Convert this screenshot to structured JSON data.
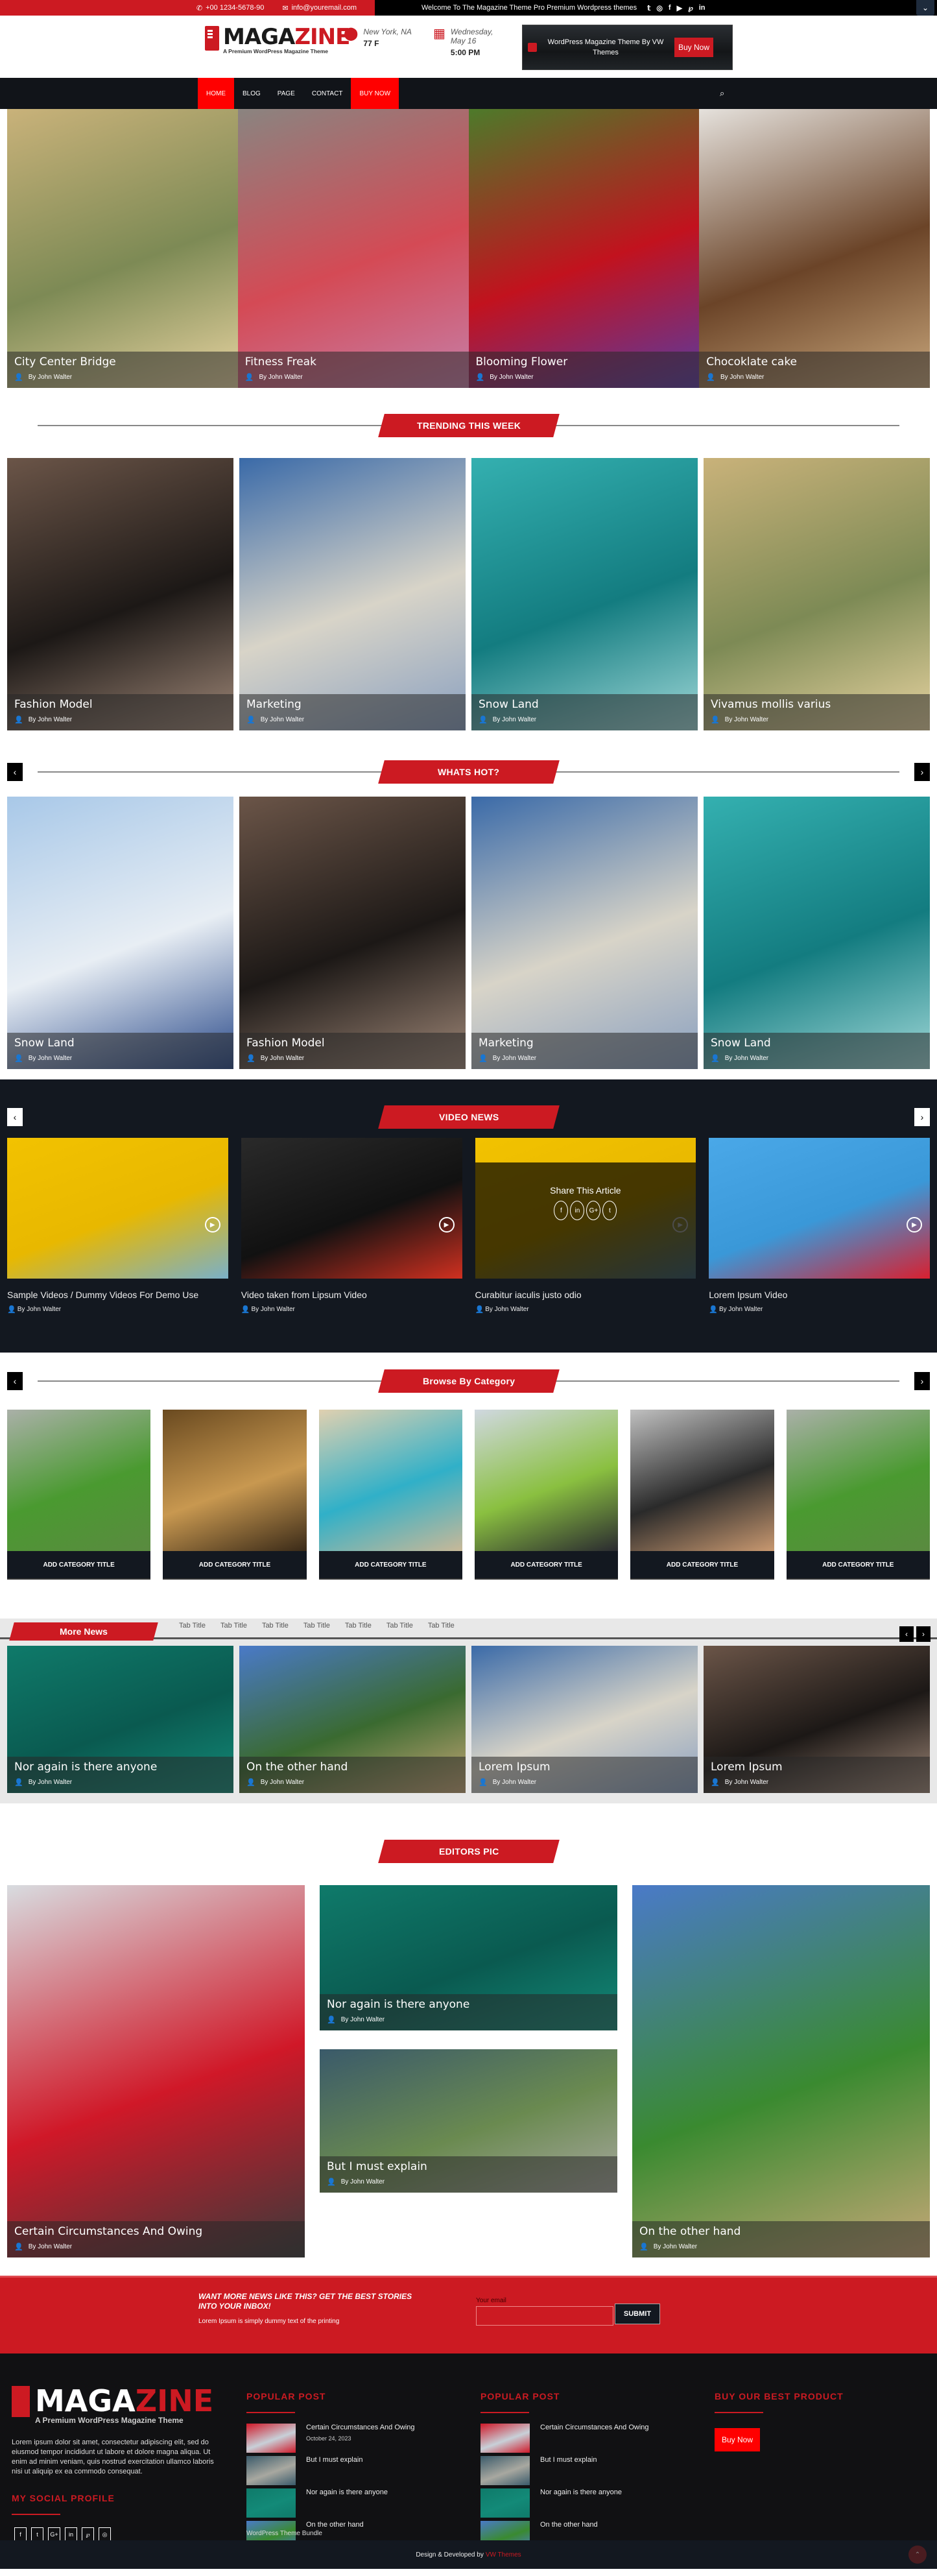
{
  "topbar": {
    "phone": "+00 1234-5678-90",
    "email": "info@youremail.com",
    "welcome": "Welcome To The Magazine Theme Pro Premium Wordpress themes",
    "social": [
      "twitter-icon",
      "instagram-icon",
      "facebook-icon",
      "youtube-icon",
      "pinterest-icon",
      "linkedin-icon"
    ],
    "social_glyphs": [
      "𝕥",
      "◎",
      "f",
      "▶",
      "℘",
      "in"
    ],
    "toggle": "⌄"
  },
  "header": {
    "logo_main": "MAGA",
    "logo_accent": "ZINE",
    "logo_tagline": "A Premium WordPress Magazine Theme",
    "location": "New York, NA",
    "temperature": "77 F",
    "date_line1": "Wednesday,",
    "date_line2": "May 16",
    "time": "5:00 PM",
    "ad_text": "WordPress Magazine Theme By VW Themes",
    "ad_button": "Buy Now"
  },
  "nav": {
    "items": [
      {
        "label": "HOME",
        "active": true
      },
      {
        "label": "BLOG",
        "active": false
      },
      {
        "label": "PAGE",
        "active": false
      },
      {
        "label": "CONTACT",
        "active": false
      },
      {
        "label": "BUY NOW",
        "active": true
      }
    ],
    "search_icon": "⌕"
  },
  "author": "By John Walter",
  "hero": [
    {
      "title": "City Center Bridge",
      "colors": [
        "#c9b27a",
        "#7d8a55",
        "#e7d3a0"
      ]
    },
    {
      "title": "Fitness Freak",
      "colors": [
        "#8a8480",
        "#d44a55",
        "#c67fa8"
      ]
    },
    {
      "title": "Blooming Flower",
      "colors": [
        "#4d7a2a",
        "#c2121e",
        "#5a3aa0"
      ]
    },
    {
      "title": "Chocoklate cake",
      "colors": [
        "#e5e1dc",
        "#6b4428",
        "#c9a77c"
      ]
    }
  ],
  "sections": {
    "trending": "TRENDING THIS WEEK",
    "whats_hot": "WHATS HOT?",
    "video_news": "VIDEO NEWS",
    "browse": "Browse By Category",
    "more_news": "More News",
    "editors": "EDITORS PIC"
  },
  "trending": [
    {
      "title": "Fashion Model",
      "colors": [
        "#6b5548",
        "#1c1816",
        "#a08878"
      ]
    },
    {
      "title": "Marketing",
      "colors": [
        "#3a6aa8",
        "#d8d4c8",
        "#8aa0c0"
      ]
    },
    {
      "title": "Snow Land",
      "colors": [
        "#34b0b0",
        "#137c80",
        "#a0d8d8"
      ]
    },
    {
      "title": "Vivamus mollis varius",
      "colors": [
        "#c9b27a",
        "#7d8a55",
        "#e7d3a0"
      ]
    }
  ],
  "whats_hot": [
    {
      "title": "Snow Land",
      "colors": [
        "#a8c8e8",
        "#e8eef4",
        "#2a4a8a"
      ]
    },
    {
      "title": "Fashion Model",
      "colors": [
        "#6b5548",
        "#1c1816",
        "#a08878"
      ]
    },
    {
      "title": "Marketing",
      "colors": [
        "#3a6aa8",
        "#d8d4c8",
        "#8aa0c0"
      ]
    },
    {
      "title": "Snow Land",
      "colors": [
        "#34b0b0",
        "#137c80",
        "#a0d8d8"
      ]
    }
  ],
  "videos": [
    {
      "title": "Sample Videos / Dummy Videos For Demo Use",
      "colors": [
        "#f2c200",
        "#e8b800",
        "#7ab0c8"
      ],
      "share": false
    },
    {
      "title": "Video taken from Lipsum Video",
      "colors": [
        "#2a2a2a",
        "#111",
        "#d03020"
      ],
      "share": false
    },
    {
      "title": "Curabitur iaculis justo odio",
      "colors": [
        "#f2c200",
        "#e8b800",
        "#7ab0c8"
      ],
      "share": true
    },
    {
      "title": "Lorem Ipsum Video",
      "colors": [
        "#4aa8e8",
        "#3a98d8",
        "#d82030"
      ],
      "share": false
    }
  ],
  "share": {
    "title": "Share This Article",
    "icons": [
      {
        "name": "facebook-icon",
        "glyph": "f"
      },
      {
        "name": "linkedin-icon",
        "glyph": "in"
      },
      {
        "name": "google-plus-icon",
        "glyph": "G+"
      },
      {
        "name": "twitter-icon",
        "glyph": "t"
      }
    ]
  },
  "categories": [
    {
      "label": "ADD CATEGORY TITLE",
      "colors": [
        "#aab0a8",
        "#4a9a30",
        "#5a8a40"
      ]
    },
    {
      "label": "ADD CATEGORY TITLE",
      "colors": [
        "#6a4a20",
        "#c89850",
        "#3a2a18"
      ]
    },
    {
      "label": "ADD CATEGORY TITLE",
      "colors": [
        "#e0d0b0",
        "#30b0c8",
        "#c8b898"
      ]
    },
    {
      "label": "ADD CATEGORY TITLE",
      "colors": [
        "#d0d8e0",
        "#8ac040",
        "#2a2a30"
      ]
    },
    {
      "label": "ADD CATEGORY TITLE",
      "colors": [
        "#c0c0c0",
        "#2a2a2a",
        "#c89870"
      ]
    },
    {
      "label": "ADD CATEGORY TITLE",
      "colors": [
        "#aab0a8",
        "#4a9a30",
        "#5a8a40"
      ]
    }
  ],
  "more_news": {
    "tabs": [
      "Tab Title",
      "Tab Title",
      "Tab Title",
      "Tab Title",
      "Tab Title",
      "Tab Title",
      "Tab Title"
    ],
    "cards": [
      {
        "title": "Nor again is there anyone",
        "colors": [
          "#0f7a6a",
          "#0a5a50",
          "#138a78"
        ]
      },
      {
        "title": "On the other hand",
        "colors": [
          "#4a7ac8",
          "#3a6a30",
          "#c8a878"
        ]
      },
      {
        "title": "Lorem Ipsum",
        "colors": [
          "#3a6aa8",
          "#d8d4c8",
          "#8aa0c0"
        ]
      },
      {
        "title": "Lorem Ipsum",
        "colors": [
          "#6b5548",
          "#1c1816",
          "#a08878"
        ]
      }
    ]
  },
  "editors": {
    "left": {
      "title": "Certain Circumstances And Owing",
      "colors": [
        "#d8dce0",
        "#d01828",
        "#3a3a3a"
      ]
    },
    "mid_top": {
      "title": "Nor again is there anyone",
      "colors": [
        "#0f7a6a",
        "#0a5a50",
        "#138a78"
      ]
    },
    "mid_bottom": {
      "title": "But I must explain",
      "colors": [
        "#3a5a6a",
        "#6a8a50",
        "#a8a8a0"
      ]
    },
    "right": {
      "title": "On the other hand",
      "colors": [
        "#4a7ac8",
        "#3a8a30",
        "#c8a878"
      ]
    }
  },
  "newsletter": {
    "heading": "WANT MORE NEWS LIKE THIS? GET THE BEST STORIES INTO YOUR INBOX!",
    "text": "Lorem Ipsum is simply dummy text of the printing",
    "email_label": "Your email",
    "email_value": "",
    "submit": "SUBMIT"
  },
  "footer": {
    "logo_main": "MAGA",
    "logo_accent": "ZINE",
    "logo_tagline": "A Premium WordPress Magazine Theme",
    "description": "Lorem ipsum dolor sit amet, consectetur adipiscing elit, sed do eiusmod tempor incididunt ut labore et dolore magna aliqua. Ut enim ad minim veniam, quis nostrud exercitation ullamco laboris nisi ut aliquip ex ea commodo consequat.",
    "social_heading": "MY SOCIAL PROFILE",
    "social": [
      {
        "name": "facebook-icon",
        "glyph": "f"
      },
      {
        "name": "twitter-icon",
        "glyph": "t"
      },
      {
        "name": "google-plus-icon",
        "glyph": "G+"
      },
      {
        "name": "linkedin-icon",
        "glyph": "in"
      },
      {
        "name": "pinterest-icon",
        "glyph": "℘"
      },
      {
        "name": "instagram-icon",
        "glyph": "◎"
      }
    ],
    "popular_heading": "POPULAR POST",
    "popular_1": [
      {
        "title": "Certain Circumstances And Owing",
        "date": "October 24, 2023",
        "colors": [
          "#d01828",
          "#c8d0d8"
        ]
      },
      {
        "title": "But I must explain",
        "date": "",
        "colors": [
          "#3a5a6a",
          "#a8a8a0"
        ]
      },
      {
        "title": "Nor again is there anyone",
        "date": "",
        "colors": [
          "#0f7a6a",
          "#138a78"
        ]
      },
      {
        "title": "On the other hand",
        "date": "",
        "colors": [
          "#4a7ac8",
          "#3a8a30"
        ]
      }
    ],
    "popular_2": [
      {
        "title": "Certain Circumstances And Owing",
        "colors": [
          "#d01828",
          "#c8d0d8"
        ]
      },
      {
        "title": "But I must explain",
        "colors": [
          "#3a5a6a",
          "#a8a8a0"
        ]
      },
      {
        "title": "Nor again is there anyone",
        "colors": [
          "#0f7a6a",
          "#138a78"
        ]
      },
      {
        "title": "On the other hand",
        "colors": [
          "#4a7ac8",
          "#3a8a30"
        ]
      }
    ],
    "buy_heading": "BUY OUR BEST PRODUCT",
    "buy_button": "Buy Now",
    "bundle": "WordPress Theme Bundle",
    "copyright_prefix": "Design & Developed by",
    "copyright_link": "VW Themes"
  },
  "colors": {
    "accent": "#cc1a22",
    "dark": "#131820",
    "nav_active": "#ff0000"
  }
}
